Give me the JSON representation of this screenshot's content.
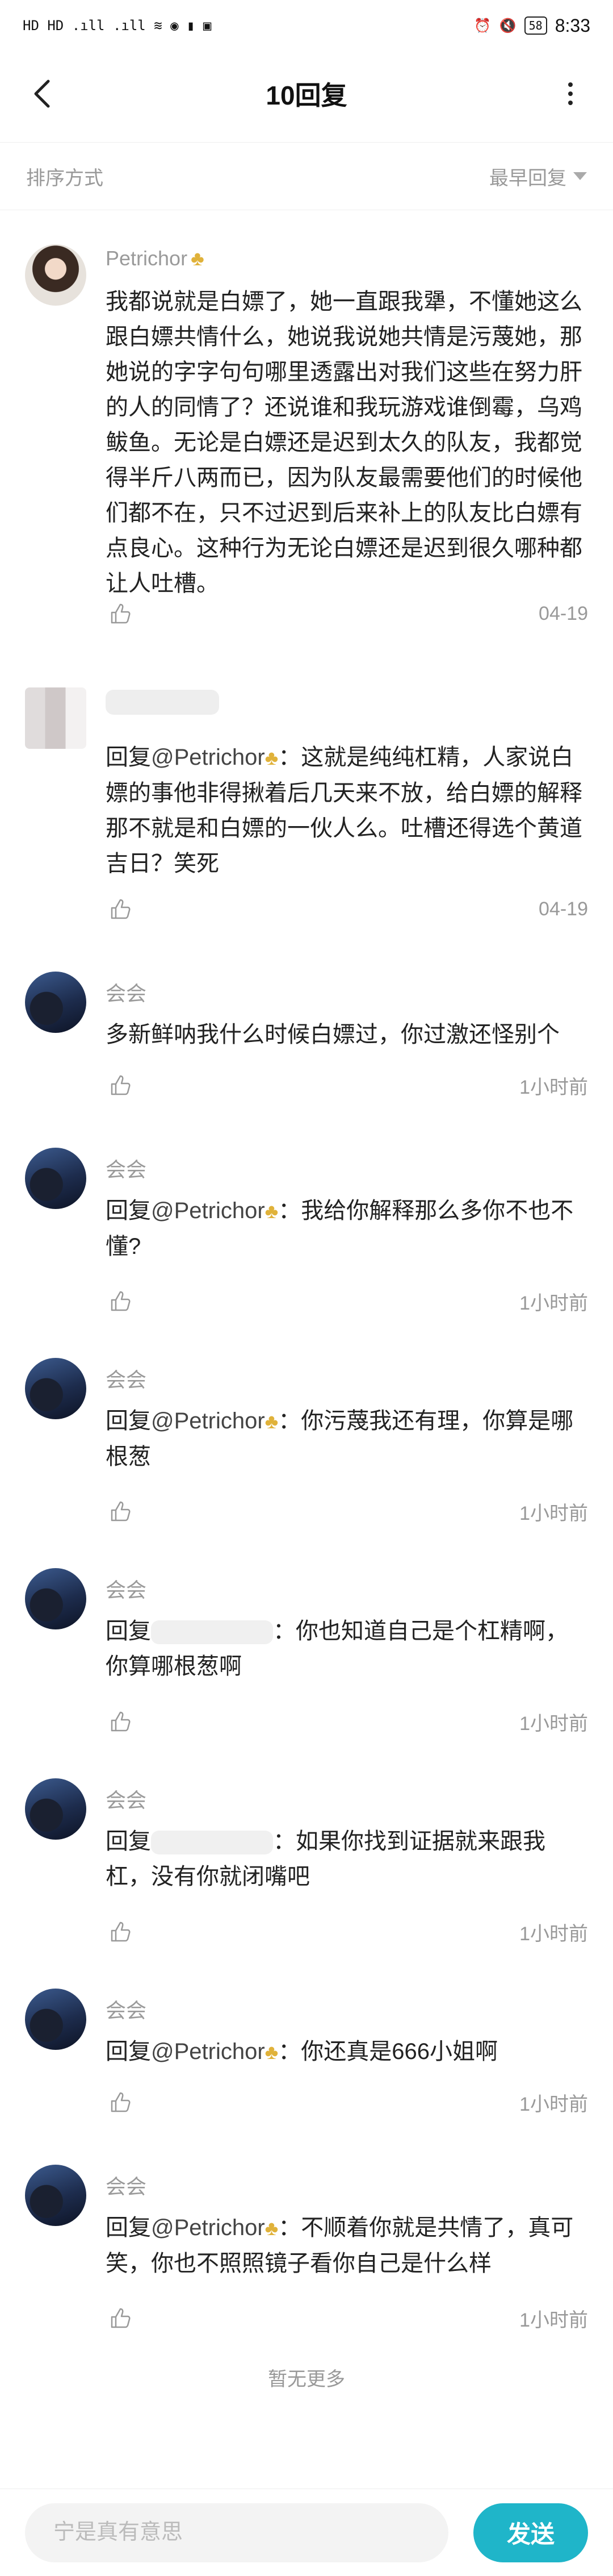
{
  "status_bar": {
    "left_text": "HD HD  .ıll .ıll  ≋ ◉ ▮ ▣",
    "right_text": "⏰ 🔇",
    "battery": "58",
    "time": "8:33"
  },
  "header": {
    "title": "10回复"
  },
  "sort": {
    "label": "排序方式",
    "value": "最早回复"
  },
  "comments": [
    {
      "username": "Petrichor",
      "text": "我都说就是白嫖了，她一直跟我犟，不懂她这么跟白嫖共情什么，她说我说她共情是污蔑她，那她说的字字句句哪里透露出对我们这些在努力肝的人的同情了？还说谁和我玩游戏谁倒霉，乌鸡鲅鱼。无论是白嫖还是迟到太久的队友，我都觉得半斤八两而已，因为队友最需要他们的时候他们都不在，只不过迟到后来补上的队友比白嫖有点良心。这种行为无论白嫖还是迟到很久哪种都让人吐槽。",
      "time": "04-19"
    },
    {
      "username": "",
      "reply_prefix": "回复",
      "mention": "@Petrichor",
      "text": "：这就是纯纯杠精，人家说白嫖的事他非得揪着后几天来不放，给白嫖的解释那不就是和白嫖的一伙人么。吐槽还得选个黄道吉日？笑死",
      "time": "04-19"
    },
    {
      "username": "会会",
      "text": "多新鲜呐我什么时候白嫖过，你过激还怪别个",
      "time": "1小时前"
    },
    {
      "username": "会会",
      "reply_prefix": "回复",
      "mention": "@Petrichor",
      "text": "：我给你解释那么多你不也不懂?",
      "time": "1小时前"
    },
    {
      "username": "会会",
      "reply_prefix": "回复",
      "mention": "@Petrichor",
      "text": "：你污蔑我还有理，你算是哪根葱",
      "time": "1小时前"
    },
    {
      "username": "会会",
      "reply_prefix": "回复",
      "text": "：你也知道自己是个杠精啊，你算哪根葱啊",
      "time": "1小时前"
    },
    {
      "username": "会会",
      "reply_prefix": "回复",
      "text": "：如果你找到证据就来跟我杠，没有你就闭嘴吧",
      "time": "1小时前"
    },
    {
      "username": "会会",
      "reply_prefix": "回复",
      "mention": "@Petrichor",
      "text": "：你还真是666小姐啊",
      "time": "1小时前"
    },
    {
      "username": "会会",
      "reply_prefix": "回复",
      "mention": "@Petrichor",
      "text": "：不顺着你就是共情了，真可笑，你也不照照镜子看你自己是什么样",
      "time": "1小时前"
    }
  ],
  "footer": {
    "no_more": "暂无更多"
  },
  "composer": {
    "placeholder": "宁是真有意思",
    "send_label": "发送"
  },
  "colors": {
    "accent": "#1fb5c9",
    "badge": "#e0b23a",
    "muted_text": "#999999"
  },
  "icons": [
    "back-arrow-icon",
    "more-vertical-icon",
    "dropdown-triangle-icon",
    "wheat-badge-icon",
    "thumbs-up-icon"
  ]
}
